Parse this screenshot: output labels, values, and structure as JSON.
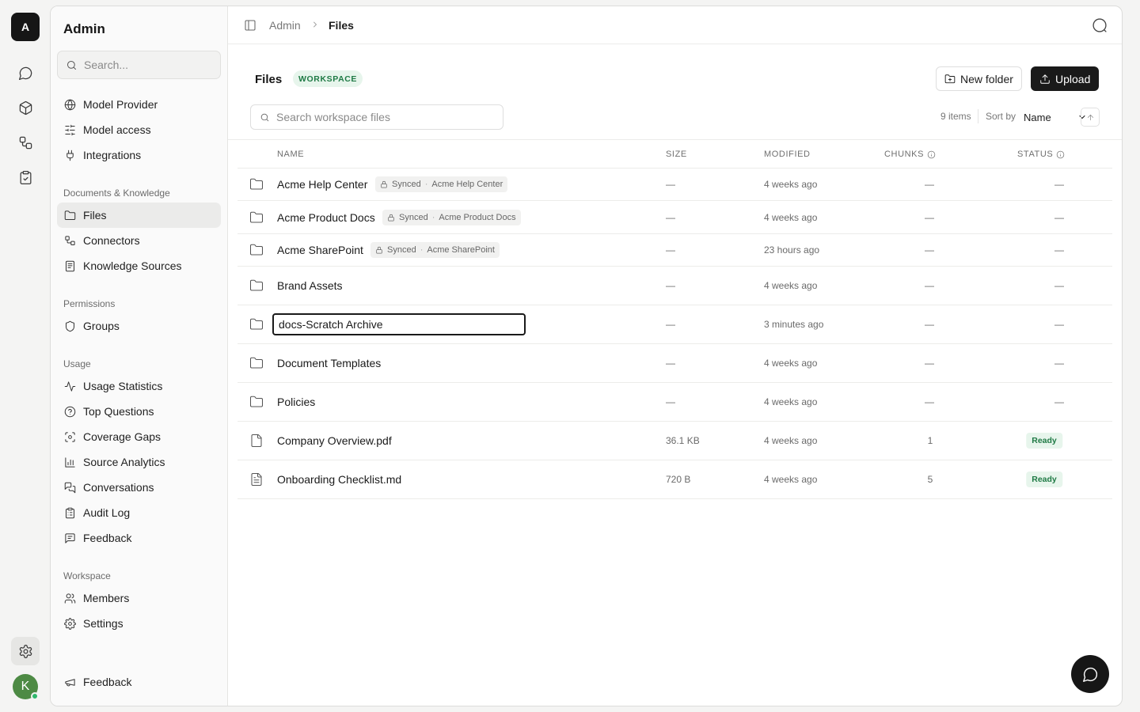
{
  "rail": {
    "logo_letter": "A",
    "avatar_letter": "K",
    "items": [
      "chat-icon",
      "cube-icon",
      "workflow-icon",
      "clipboard-icon"
    ],
    "settings_icon": "gear-icon"
  },
  "sidebar": {
    "title": "Admin",
    "search_placeholder": "Search...",
    "items_top": [
      {
        "label": "Model Provider",
        "icon": "globe-icon"
      },
      {
        "label": "Model access",
        "icon": "sliders-icon"
      },
      {
        "label": "Integrations",
        "icon": "plug-icon"
      }
    ],
    "section_docs": "Documents & Knowledge",
    "items_docs": [
      {
        "label": "Files",
        "icon": "folder-icon",
        "active": true
      },
      {
        "label": "Connectors",
        "icon": "connector-icon"
      },
      {
        "label": "Knowledge Sources",
        "icon": "book-icon"
      }
    ],
    "section_permissions": "Permissions",
    "items_permissions": [
      {
        "label": "Groups",
        "icon": "shield-icon"
      }
    ],
    "section_usage": "Usage",
    "items_usage": [
      {
        "label": "Usage Statistics",
        "icon": "activity-icon"
      },
      {
        "label": "Top Questions",
        "icon": "help-circle-icon"
      },
      {
        "label": "Coverage Gaps",
        "icon": "scan-icon"
      },
      {
        "label": "Source Analytics",
        "icon": "bar-chart-icon"
      },
      {
        "label": "Conversations",
        "icon": "messages-icon"
      },
      {
        "label": "Audit Log",
        "icon": "clipboard-list-icon"
      },
      {
        "label": "Feedback",
        "icon": "message-square-icon"
      }
    ],
    "section_workspace": "Workspace",
    "items_workspace": [
      {
        "label": "Members",
        "icon": "users-icon"
      },
      {
        "label": "Settings",
        "icon": "gear-icon"
      }
    ],
    "bottom_item": {
      "label": "Feedback",
      "icon": "megaphone-icon"
    }
  },
  "breadcrumb": {
    "root": "Admin",
    "current": "Files"
  },
  "page": {
    "title": "Files",
    "badge": "WORKSPACE",
    "new_folder_label": "New folder",
    "upload_label": "Upload",
    "search_placeholder": "Search workspace files",
    "items_count": "9 items",
    "sort_by_label": "Sort by",
    "sort_value": "Name"
  },
  "table": {
    "columns": {
      "name": "NAME",
      "size": "SIZE",
      "modified": "MODIFIED",
      "chunks": "CHUNKS",
      "status": "STATUS"
    },
    "rows": [
      {
        "type": "folder",
        "name": "Acme Help Center",
        "synced": "Synced",
        "source": "Acme Help Center",
        "size": "—",
        "modified": "4 weeks ago",
        "chunks": "—",
        "status": "—"
      },
      {
        "type": "folder",
        "name": "Acme Product Docs",
        "synced": "Synced",
        "source": "Acme Product Docs",
        "size": "—",
        "modified": "4 weeks ago",
        "chunks": "—",
        "status": "—"
      },
      {
        "type": "folder",
        "name": "Acme SharePoint",
        "synced": "Synced",
        "source": "Acme SharePoint",
        "size": "—",
        "modified": "23 hours ago",
        "chunks": "—",
        "status": "—"
      },
      {
        "type": "folder",
        "name": "Brand Assets",
        "size": "—",
        "modified": "4 weeks ago",
        "chunks": "—",
        "status": "—"
      },
      {
        "type": "folder-editing",
        "name": "docs-Scratch Archive",
        "size": "—",
        "modified": "3 minutes ago",
        "chunks": "—",
        "status": "—"
      },
      {
        "type": "folder",
        "name": "Document Templates",
        "size": "—",
        "modified": "4 weeks ago",
        "chunks": "—",
        "status": "—"
      },
      {
        "type": "folder",
        "name": "Policies",
        "size": "—",
        "modified": "4 weeks ago",
        "chunks": "—",
        "status": "—"
      },
      {
        "type": "file",
        "name": "Company Overview.pdf",
        "size": "36.1 KB",
        "modified": "4 weeks ago",
        "chunks": "1",
        "status": "Ready"
      },
      {
        "type": "file-text",
        "name": "Onboarding Checklist.md",
        "size": "720 B",
        "modified": "4 weeks ago",
        "chunks": "5",
        "status": "Ready"
      }
    ]
  },
  "colors": {
    "accent": "#1a1a1a",
    "ready_bg": "#e7f5ec",
    "ready_text": "#1f7a45",
    "avatar": "#4d8a44"
  }
}
